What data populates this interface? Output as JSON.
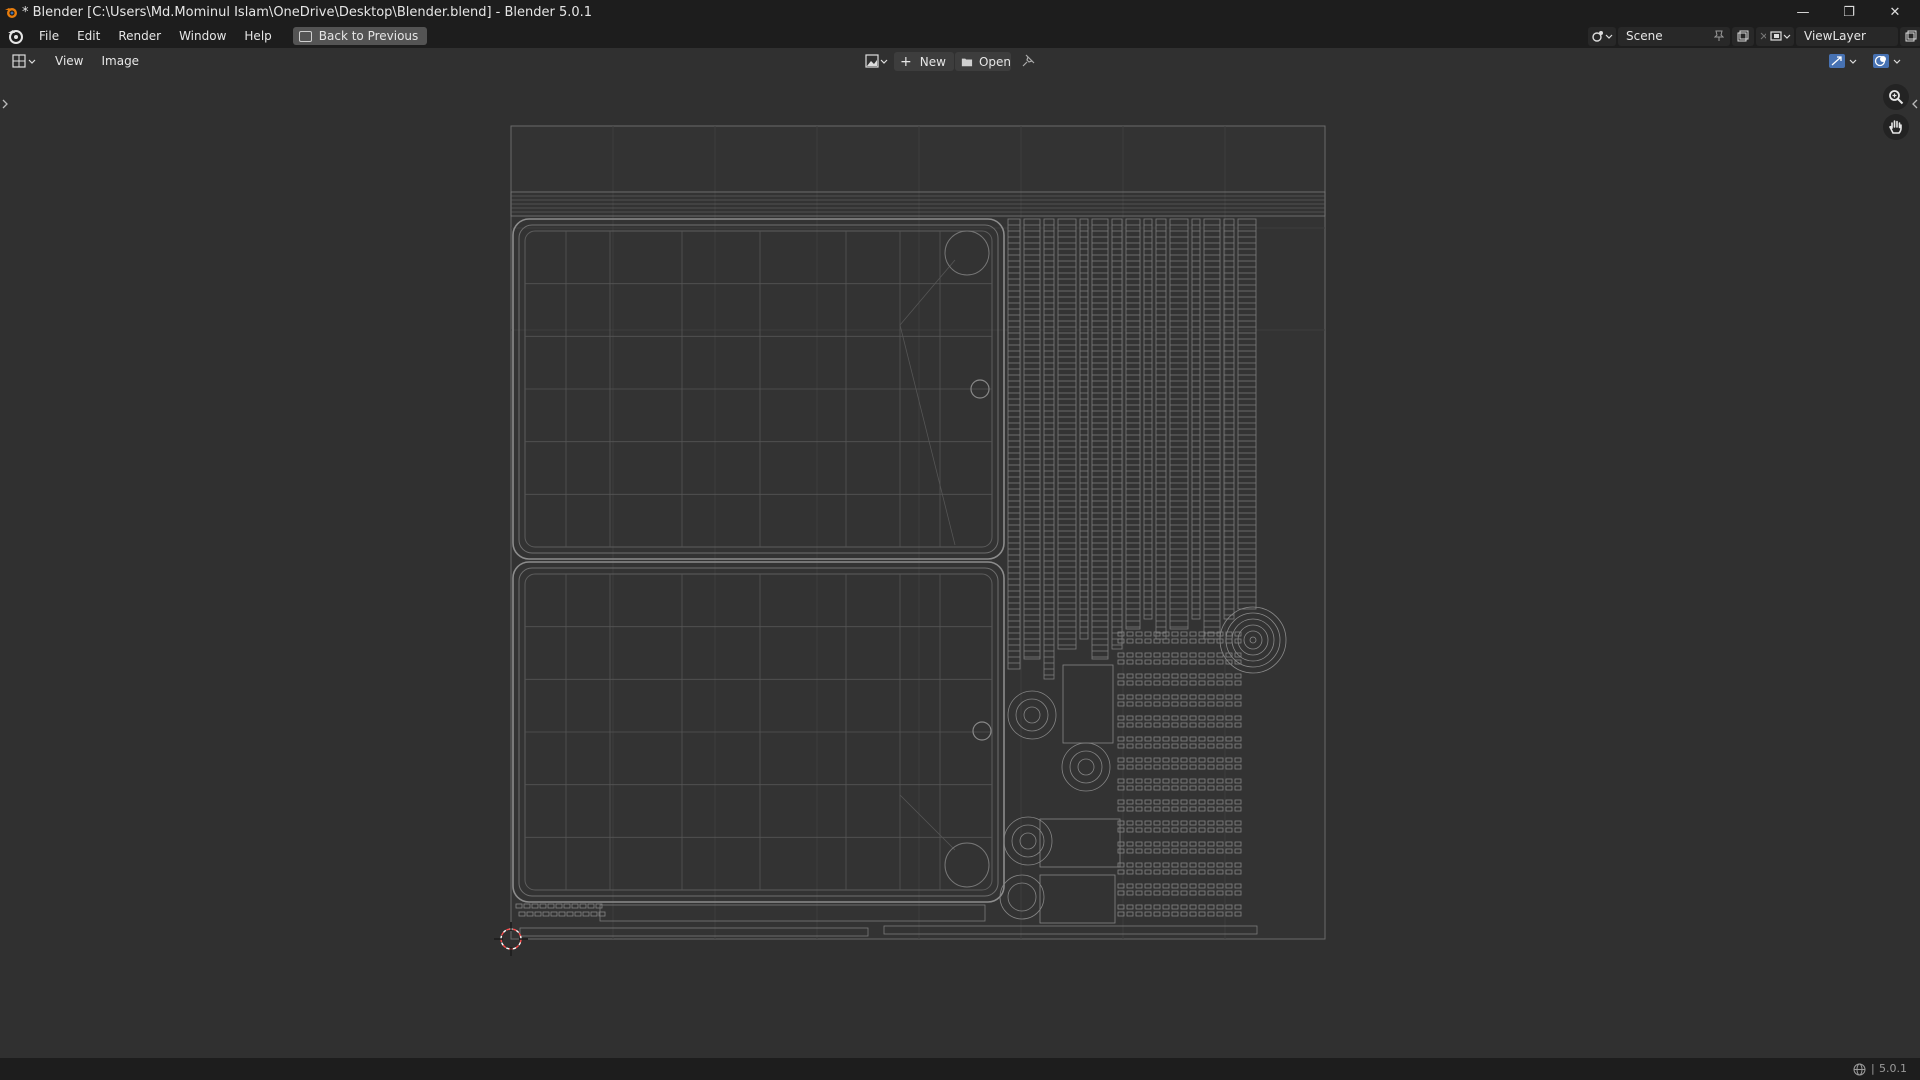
{
  "window": {
    "title": "* Blender [C:\\Users\\Md.Mominul Islam\\OneDrive\\Desktop\\Blender.blend] - Blender 5.0.1",
    "minimize_glyph": "—",
    "maximize_glyph": "❐",
    "close_glyph": "✕"
  },
  "menu": {
    "items": [
      "File",
      "Edit",
      "Render",
      "Window",
      "Help"
    ],
    "back_label": "Back to Previous"
  },
  "scene": {
    "name": "Scene"
  },
  "view_layer": {
    "name": "ViewLayer"
  },
  "editor_header": {
    "menus": [
      "View",
      "Image"
    ],
    "new_label": "New",
    "open_label": "Open"
  },
  "status": {
    "version": "5.0.1"
  },
  "colors": {
    "background": "#303030",
    "header": "#1d1d1d",
    "uv_bounds": "#3a3a3a",
    "wire": "#9a9a9a"
  }
}
